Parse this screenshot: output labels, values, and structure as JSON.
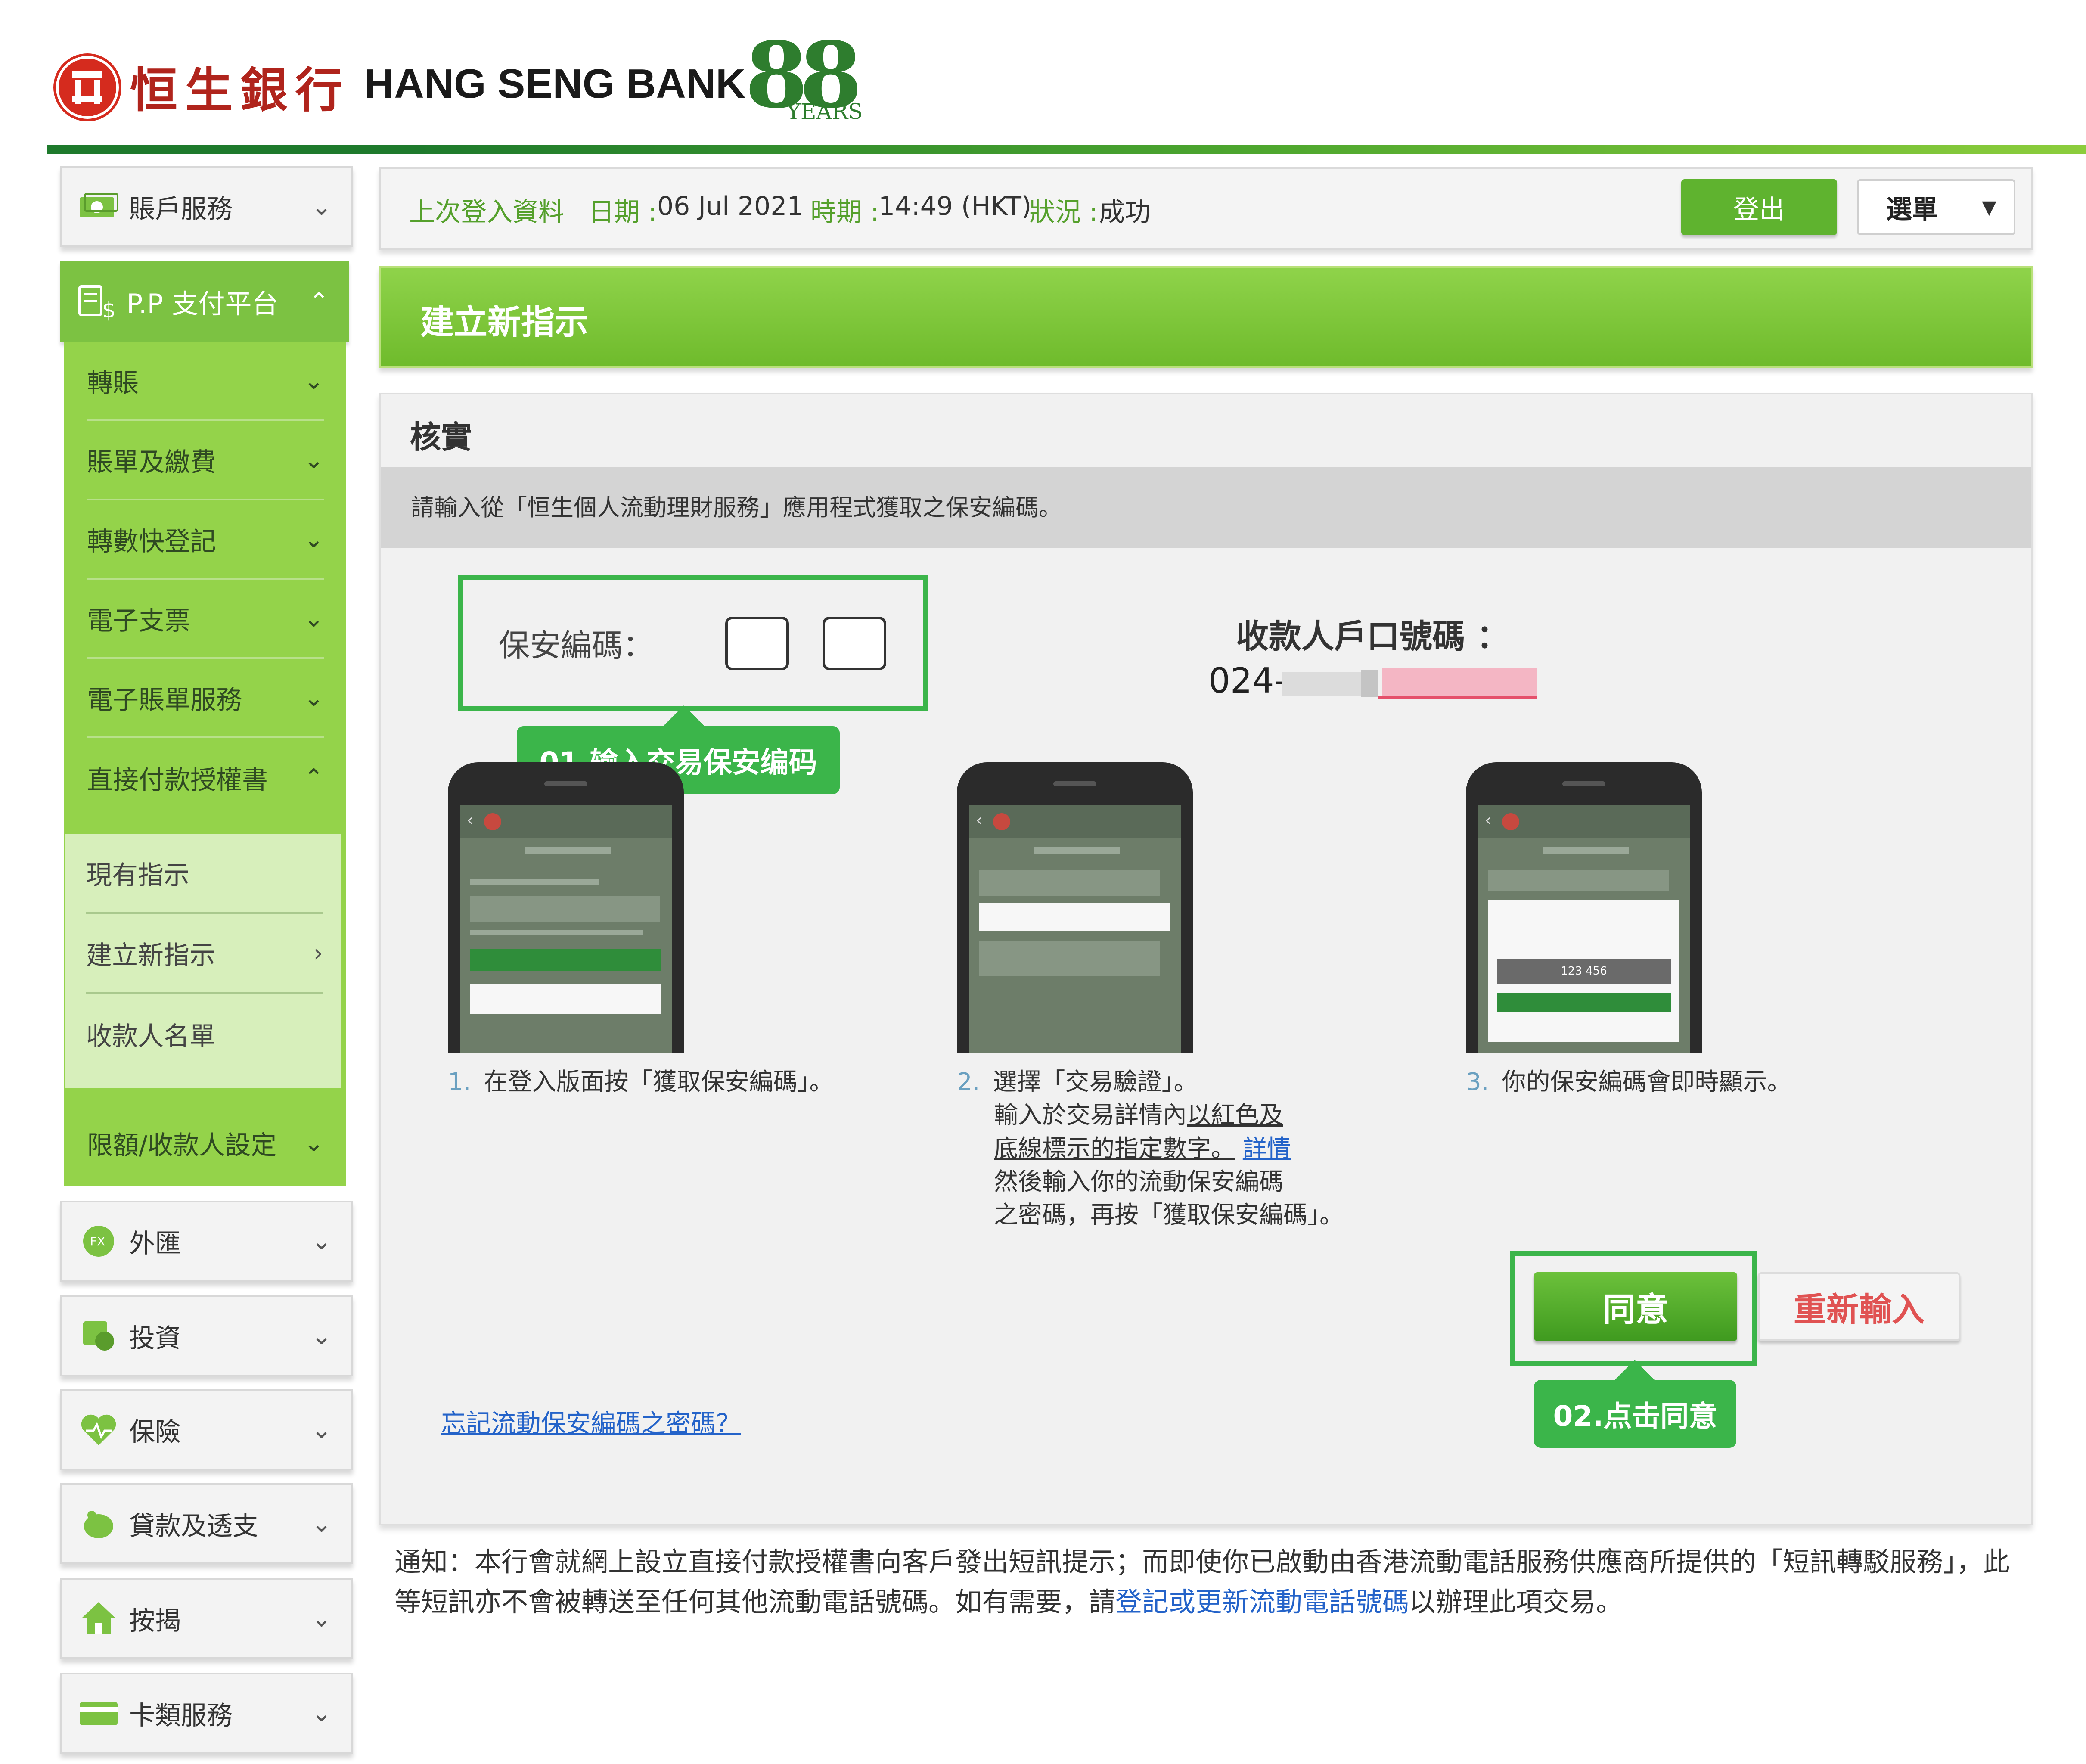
{
  "brand": {
    "name_zh": "恒生銀行",
    "name_en": "HANG SENG BANK",
    "anniversary_number": "88",
    "anniversary_text": "YEARS"
  },
  "sidebar": {
    "account_services": "賬戶服務",
    "pp_platform": "P.P 支付平台",
    "pp_items": [
      "轉賬",
      "賬單及繳費",
      "轉數快登記",
      "電子支票",
      "電子賬單服務",
      "直接付款授權書"
    ],
    "sub_items": [
      "現有指示",
      "建立新指示",
      "收款人名單"
    ],
    "limit_settings": "限額/收款人設定",
    "others": [
      "外匯",
      "投資",
      "保險",
      "貸款及透支",
      "按揭",
      "卡類服務"
    ]
  },
  "topbar": {
    "last_login": "上次登入資料",
    "date_label": "日期 :",
    "date_value": "06 Jul 2021",
    "time_label": "時期 :",
    "time_value": "14:49 (HKT)",
    "status_label": "狀況 :",
    "status_value": "成功",
    "logout": "登出",
    "menu": "選單"
  },
  "page": {
    "title": "建立新指示",
    "section_title": "核實",
    "instruction": "請輸入從「恒生個人流動理財服務」應用程式獲取之保安編碼。",
    "code_label": "保安編碼：",
    "callout_1": "01.输入交易保安编码",
    "payee_label": "收款人戶口號碼 ：",
    "payee_prefix": "024-",
    "steps": {
      "s1_num": "1.",
      "s1_text": "在登入版面按「獲取保安編碼」。",
      "s2_num": "2.",
      "s2_l1": "選擇「交易驗證」。",
      "s2_l2a": "輸入於交易詳情內",
      "s2_l2b": "以紅色及",
      "s2_l3a": "底線標示的指定數字。",
      "s2_l3b": "詳情",
      "s2_l4": "然後輸入你的流動保安編碼",
      "s2_l5": "之密碼，再按「獲取保安編碼」。",
      "s3_num": "3.",
      "s3_text": "你的保安編碼會即時顯示。"
    },
    "phone_code": "123 456",
    "agree": "同意",
    "reset": "重新輸入",
    "callout_2": "02.点击同意",
    "forgot_link": "忘記流動保安編碼之密碼？"
  },
  "notice": {
    "part1": "通知：本行會就網上設立直接付款授權書向客戶發出短訊提示；而即使你已啟動由香港流動電話服務供應商所提供的「短訊轉駁服務」，此等短訊亦不會被轉送至任何其他流動電話號碼。如有需要，請",
    "link": "登記或更新流動電話號碼",
    "part2": "以辦理此項交易。"
  },
  "colors": {
    "brand_red": "#d52b1e",
    "accent_green": "#7cc242",
    "callout_green": "#3bb54a",
    "link_blue": "#2463c9"
  },
  "icons": [
    "hang-seng-logo-icon",
    "money-icon",
    "pp-payment-icon",
    "fx-icon",
    "investment-icon",
    "insurance-icon",
    "loan-icon",
    "mortgage-icon",
    "card-icon",
    "chevron-down-icon",
    "chevron-up-icon",
    "chevron-right-icon"
  ]
}
